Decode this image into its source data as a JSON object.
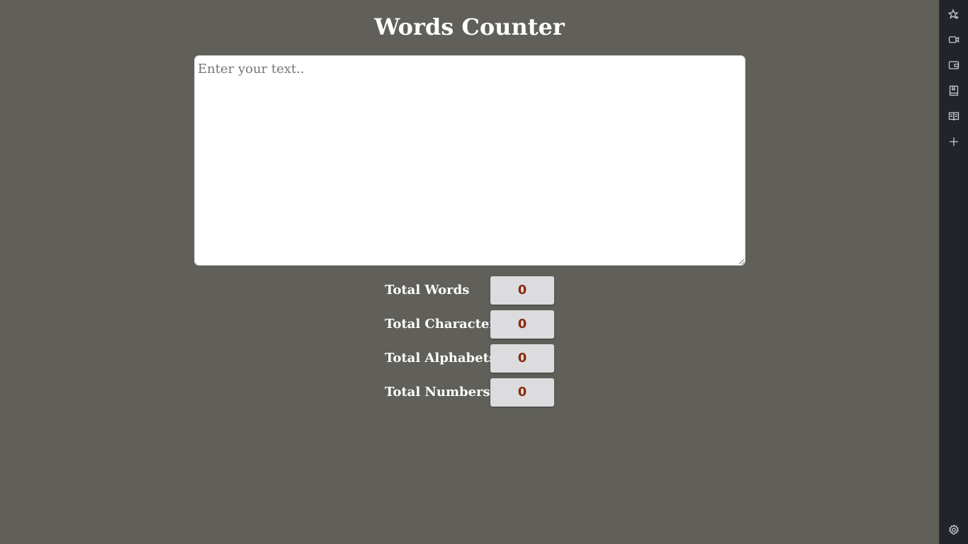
{
  "page": {
    "title": "Words Counter"
  },
  "input": {
    "placeholder": "Enter your text..",
    "value": ""
  },
  "stats": [
    {
      "label": "Total Words",
      "value": "0"
    },
    {
      "label": "Total Characters",
      "value": "0"
    },
    {
      "label": "Total Alphabets",
      "value": "0"
    },
    {
      "label": "Total Numbers",
      "value": "0"
    }
  ],
  "sidebar": {
    "icons": [
      "sparkle-star-icon",
      "video-camera-icon",
      "wallet-icon",
      "bookmark-book-icon",
      "reading-book-icon",
      "plus-icon",
      "gear-icon"
    ]
  },
  "colors": {
    "background": "#605f5a",
    "sidebar": "#212529",
    "stat_value_text": "#8c2a10",
    "stat_value_bg": "#dcdcde"
  }
}
